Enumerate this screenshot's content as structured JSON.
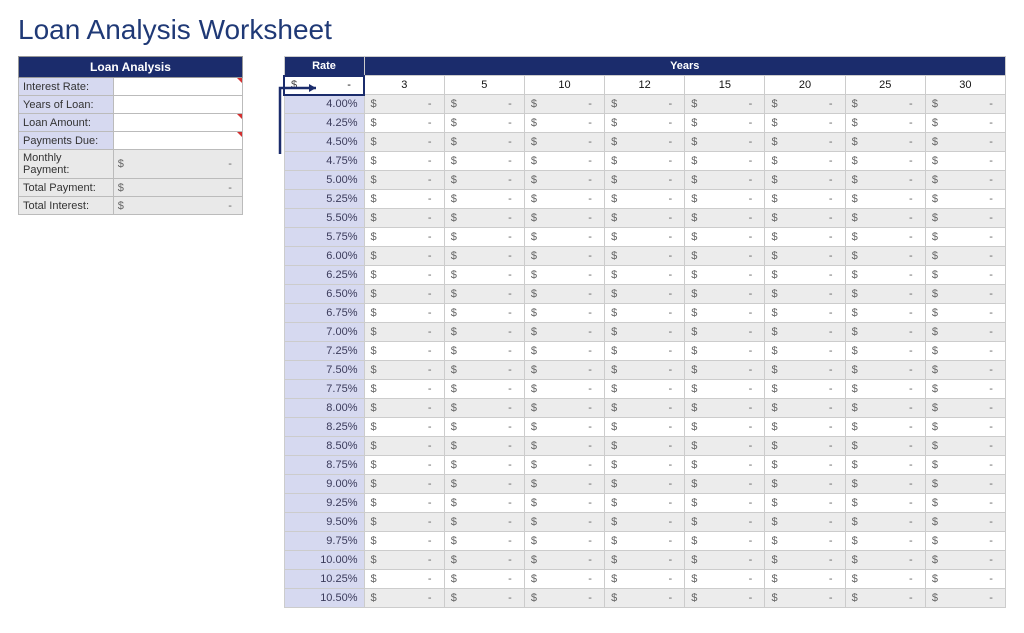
{
  "page_title": "Loan Analysis Worksheet",
  "loan_box": {
    "header": "Loan Analysis",
    "rows": [
      {
        "label": "Interest Rate:",
        "value": "",
        "style": "lav",
        "redtick": true
      },
      {
        "label": "Years of Loan:",
        "value": "",
        "style": "lav",
        "redtick": false
      },
      {
        "label": "Loan Amount:",
        "value": "",
        "style": "lav",
        "redtick": true
      },
      {
        "label": "Payments Due:",
        "value": "",
        "style": "lav",
        "redtick": true
      },
      {
        "label": "Monthly Payment:",
        "value": "$ -",
        "style": "grey",
        "redtick": false,
        "money": true
      },
      {
        "label": "Total Payment:",
        "value": "$ -",
        "style": "grey",
        "redtick": false,
        "money": true
      },
      {
        "label": "Total Interest:",
        "value": "$ -",
        "style": "grey",
        "redtick": false,
        "money": true
      }
    ]
  },
  "grid": {
    "rate_header": "Rate",
    "years_header": "Years",
    "formula_cell": "$ -",
    "year_columns": [
      "3",
      "5",
      "10",
      "12",
      "15",
      "20",
      "25",
      "30"
    ],
    "rates": [
      "4.00%",
      "4.25%",
      "4.50%",
      "4.75%",
      "5.00%",
      "5.25%",
      "5.50%",
      "5.75%",
      "6.00%",
      "6.25%",
      "6.50%",
      "6.75%",
      "7.00%",
      "7.25%",
      "7.50%",
      "7.75%",
      "8.00%",
      "8.25%",
      "8.50%",
      "8.75%",
      "9.00%",
      "9.25%",
      "9.50%",
      "9.75%",
      "10.00%",
      "10.25%",
      "10.50%"
    ],
    "cell_value": "$ -"
  },
  "colors": {
    "navy": "#1b2c6c",
    "lavender": "#d6d9f0",
    "grey": "#ececec"
  }
}
